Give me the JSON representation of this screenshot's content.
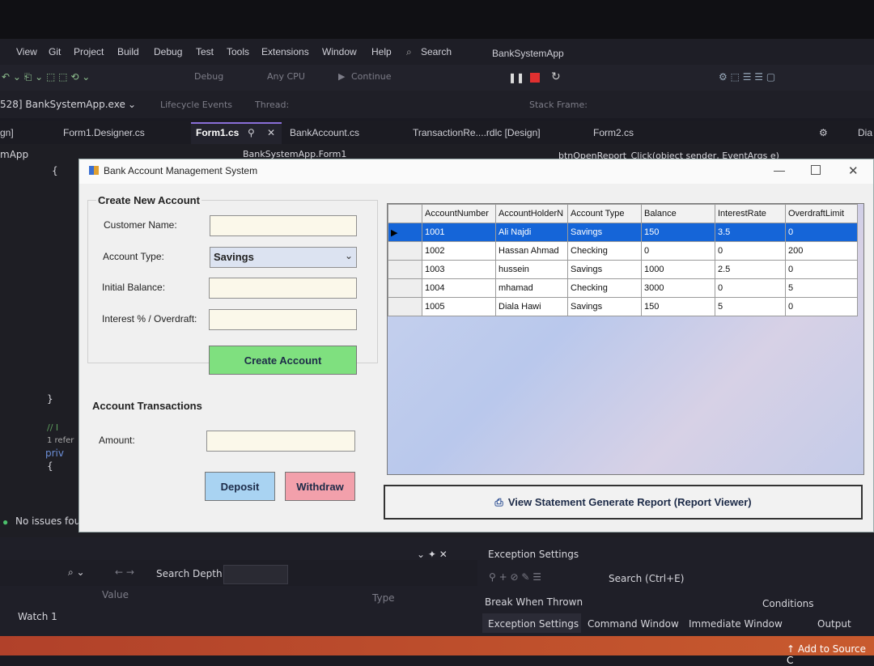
{
  "menu": {
    "items": [
      "View",
      "Git",
      "Project",
      "Build",
      "Debug",
      "Test",
      "Tools",
      "Extensions",
      "Window",
      "Help"
    ],
    "search_label": "Search",
    "app_title": "BankSystemApp"
  },
  "toolbar": {
    "debug_config": "Debug",
    "platform": "Any CPU",
    "continue_label": "Continue"
  },
  "debug_bar": {
    "process": "528] BankSystemApp.exe",
    "lifecycle": "Lifecycle Events",
    "thread": "Thread:",
    "stack_frame": "Stack Frame:"
  },
  "doc_tabs": [
    "Form1.Designer.cs",
    "Form1.cs",
    "BankAccount.cs",
    "TransactionRe....rdlc [Design]",
    "Form2.cs"
  ],
  "editor": {
    "left_tab_fragment": "gn]",
    "project_fragment": "mApp",
    "nav_class": "BankSystemApp.Form1",
    "nav_member": "btnOpenReport_Click(object sender, EventArgs e)",
    "brace_open": "{",
    "brace_close": "}",
    "comment_fragment": "// I",
    "refs_fragment": "1 refer",
    "code_fragment": "priv",
    "brace_open2": "{",
    "issues": "No issues fou",
    "right_fragment": "Dia"
  },
  "form": {
    "title": "Bank Account Management System",
    "create_group": "Create New Account",
    "customer_name_label": "Customer Name:",
    "customer_name_value": "",
    "account_type_label": "Account Type:",
    "account_type_value": "Savings",
    "initial_balance_label": "Initial Balance:",
    "initial_balance_value": "",
    "interest_label": "Interest % / Overdraft:",
    "interest_value": "",
    "create_button": "Create Account",
    "transactions_group": "Account Transactions",
    "amount_label": "Amount:",
    "amount_value": "",
    "deposit_button": "Deposit",
    "withdraw_button": "Withdraw",
    "report_button": "View Statement  Generate Report (Report Viewer)",
    "colors": {
      "create": "#7fe07f",
      "deposit": "#a9d3f2",
      "withdraw": "#f2a0ab",
      "selected_row": "#1565d8"
    }
  },
  "grid": {
    "columns": [
      "AccountNumber",
      "AccountHolderN",
      "Account Type",
      "Balance",
      "InterestRate",
      "OverdraftLimit"
    ],
    "rows": [
      [
        "1001",
        "Ali Najdi",
        "Savings",
        "150",
        "3.5",
        "0"
      ],
      [
        "1002",
        "Hassan Ahmad",
        "Checking",
        "0",
        "0",
        "200"
      ],
      [
        "1003",
        "hussein",
        "Savings",
        "1000",
        "2.5",
        "0"
      ],
      [
        "1004",
        "mhamad",
        "Checking",
        "3000",
        "0",
        "5"
      ],
      [
        "1005",
        "Diala Hawi",
        "Savings",
        "150",
        "5",
        "0"
      ]
    ],
    "selected_row": 0
  },
  "bottom": {
    "search_depth": "Search Depth:",
    "value_header": "Value",
    "type_header": "Type",
    "watch_tab": "Watch 1",
    "exception_settings_title": "Exception Settings",
    "search_placeholder": "Search (Ctrl+E)",
    "break_when_thrown": "Break When Thrown",
    "conditions": "Conditions",
    "tabs": [
      "Exception Settings",
      "Command Window",
      "Immediate Window",
      "Output"
    ],
    "add_to_source": "Add to Source C"
  }
}
